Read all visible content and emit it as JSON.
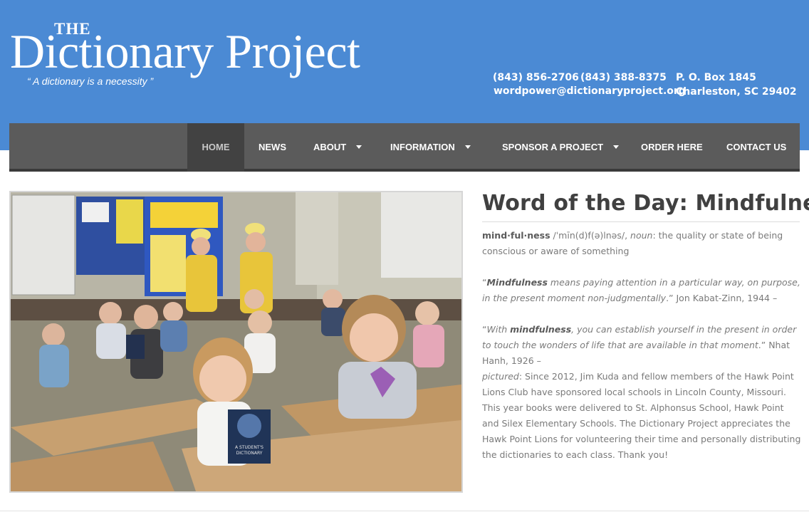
{
  "brand": {
    "the": "THE",
    "name": "Dictionary Project",
    "tagline": "“ A dictionary is a necessity ”"
  },
  "contact": {
    "phone1": "(843) 856-2706",
    "phone2": "(843) 388-8375",
    "email": "wordpower@dictionaryproject.org",
    "po_box": "P. O. Box 1845",
    "city": "Charleston, SC 29402"
  },
  "nav": {
    "home": "HOME",
    "news": "NEWS",
    "about": "ABOUT",
    "information": "INFORMATION",
    "sponsor": "SPONSOR A PROJECT",
    "order": "ORDER HERE",
    "contact": "CONTACT US"
  },
  "photo": {
    "book_label_1": "A STUDENT'S",
    "book_label_2": "DICTIONARY"
  },
  "article": {
    "title": "Word of the Day: Mindfulness",
    "headword": "mind·ful·ness",
    "pronunciation": " /ˈmīn(d)f(ə)lnəs/, ",
    "pos": "noun",
    "definition": ": the quality or state of being conscious or aware of something",
    "quote1_open": "“",
    "quote1_word": "Mindfulness",
    "quote1_text": " means paying attention in a particular way, on purpose, in the present moment non-judgmentally",
    "quote1_attrib": ".” Jon Kabat-Zinn, 1944 –",
    "quote2_open": "“",
    "quote2_with": "With ",
    "quote2_word": "mindfulness",
    "quote2_text": ", you can establish yourself in the present in order to touch the wonders of life that are available in that moment",
    "quote2_attrib": ".” Nhat Hanh, 1926 –",
    "pictured_label": "pictured",
    "pictured_text": ": Since 2012, Jim Kuda and fellow members of the Hawk Point Lions Club have sponsored local schools in Lincoln County, Missouri. This year books were delivered to St. Alphonsus School, Hawk Point and Silex Elementary Schools. The Dictionary Project appreciates the Hawk Point Lions for volunteering their time and personally distributing the dictionaries to each class. Thank you!"
  },
  "colors": {
    "header_blue": "#4b8ad4",
    "nav_gray": "#5b5b5b",
    "nav_active": "#424242"
  }
}
